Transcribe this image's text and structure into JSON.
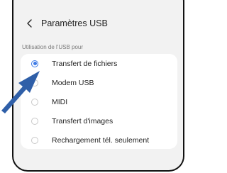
{
  "header": {
    "title": "Paramètres USB"
  },
  "section": {
    "label": "Utilisation de l'USB pour"
  },
  "options": [
    {
      "label": "Transfert de fichiers",
      "selected": true
    },
    {
      "label": "Modem USB",
      "selected": false
    },
    {
      "label": "MIDI",
      "selected": false
    },
    {
      "label": "Transfert d'images",
      "selected": false
    },
    {
      "label": "Rechargement tél. seulement",
      "selected": false
    }
  ],
  "colors": {
    "accent": "#3e7be6",
    "arrow": "#2f5fa8",
    "card": "#ffffff",
    "screen_bg": "#f2f2f2"
  },
  "icons": {
    "back": "chevron-left-icon",
    "pointer": "arrow-icon"
  }
}
